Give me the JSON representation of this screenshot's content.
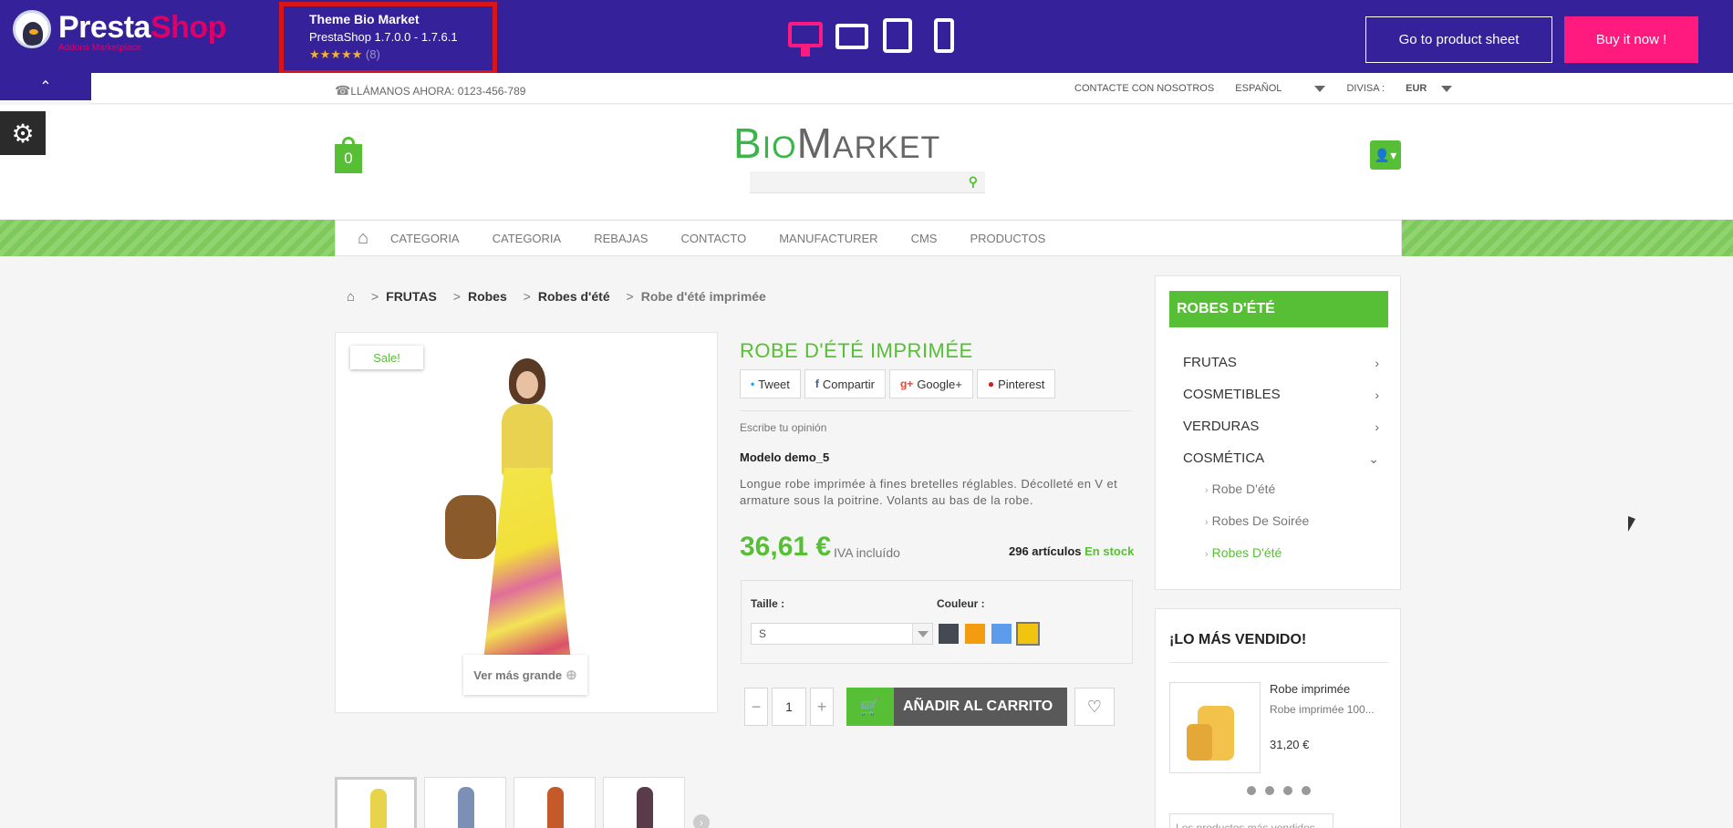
{
  "topbar": {
    "brand_part1": "Presta",
    "brand_part2": "Shop",
    "brand_sub": "Addons Marketplace",
    "theme_title": "Theme Bio Market",
    "theme_version": "PrestaShop 1.7.0.0 - 1.7.6.1",
    "rating_stars": "★★★★★",
    "rating_count": "(8)",
    "go_sheet": "Go to product sheet",
    "buy_now": "Buy it now !",
    "accent_color": "#ff1a80",
    "bar_color": "#35229b"
  },
  "utility": {
    "call": "LLÁMANOS AHORA: 0123-456-789",
    "contact": "CONTACTE CON NOSOTROS",
    "language": "ESPAÑOL",
    "currency_label": "DIVISA :",
    "currency_value": "EUR"
  },
  "header": {
    "cart_count": "0",
    "logo_b": "B",
    "logo_io": "IO",
    "logo_m": "M",
    "logo_arket": "ARKET"
  },
  "menu": {
    "items": [
      "CATEGORIA",
      "CATEGORIA",
      "REBAJAS",
      "CONTACTO",
      "MANUFACTURER",
      "CMS",
      "PRODUCTOS"
    ]
  },
  "breadcrumb": {
    "items": [
      "FRUTAS",
      "Robes",
      "Robes d'été"
    ],
    "current": "Robe d'été imprimée"
  },
  "product": {
    "sale": "Sale!",
    "zoom": "Ver más grande",
    "title": "ROBE D'ÉTÉ IMPRIMÉE",
    "share": [
      "Tweet",
      "Compartir",
      "Google+",
      "Pinterest"
    ],
    "opinion": "Escribe tu opinión",
    "model": "Modelo demo_5",
    "description": "Longue robe imprimée à fines bretelles réglables. Décolleté en V et armature sous la poitrine. Volants au bas de la robe.",
    "price": "36,61 €",
    "price_note": "IVA incluído",
    "stock_count": "296 artículos",
    "stock_status": "En stock",
    "size_label": "Taille :",
    "size_value": "S",
    "color_label": "Couleur :",
    "swatches": [
      "#434a54",
      "#f39c11",
      "#5d9cec",
      "#f1c40f"
    ],
    "quantity": "1",
    "add_to_cart": "AÑADIR AL CARRITO"
  },
  "sidebar": {
    "heading": "ROBES D'ÉTÉ",
    "categories": [
      "FRUTAS",
      "COSMETIBLES",
      "VERDURAS",
      "COSMÉTICA"
    ],
    "subcategories": [
      "Robe D'été",
      "Robes De Soirée",
      "Robes D'été"
    ],
    "bestseller_heading": "¡LO MÁS VENDIDO!",
    "bestseller_name": "Robe imprimée",
    "bestseller_desc": "Robe imprimée 100...",
    "bestseller_price": "31,20 €",
    "bestseller_more": "Los productos más vendidos"
  }
}
